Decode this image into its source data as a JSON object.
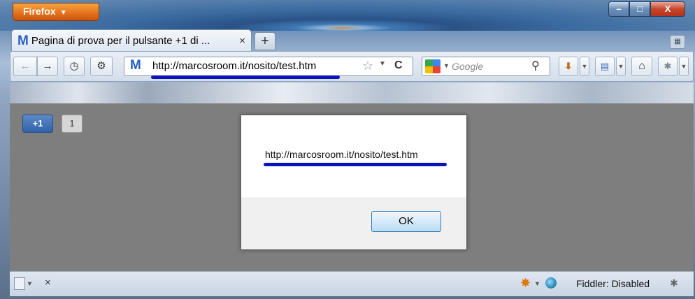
{
  "titlebar": {
    "app_button_label": "Firefox",
    "app_button_caret": "▼",
    "minimize": "–",
    "maximize": "□",
    "close": "X"
  },
  "tab": {
    "favicon": "M",
    "title": "Pagina di prova per il pulsante +1 di ...",
    "close": "×",
    "new_tab": "+",
    "list_tabs_icon": "tab-list-icon"
  },
  "navbar": {
    "back": "←",
    "forward": "→",
    "history_icon": "history-clock-icon",
    "extension_icon": "extension-icon",
    "url_favicon": "M",
    "url": "http://marcosroom.it/nosito/test.htm",
    "bookmark_star": "☆",
    "url_dropdown": "▼",
    "reload": "C",
    "search_dropdown": "▼",
    "search_placeholder": "Google",
    "search_icon": "magnifier-icon",
    "download_icon": "download-arrow-icon",
    "bookmarks_icon": "bookmarks-icon",
    "home_icon": "home-icon",
    "addon_icon": "addon-icon",
    "small_dropdown": "▼"
  },
  "content": {
    "plusone_label": "+1",
    "plusone_count": "1"
  },
  "dialog": {
    "message": "http://marcosroom.it/nosito/test.htm",
    "ok_label": "OK"
  },
  "statusbar": {
    "close": "×",
    "fiddler_status": "Fiddler: Disabled"
  },
  "colors": {
    "annotation_underline": "#0a14b8",
    "content_background": "#7e7e7e",
    "firefox_button": "#e3701b"
  }
}
